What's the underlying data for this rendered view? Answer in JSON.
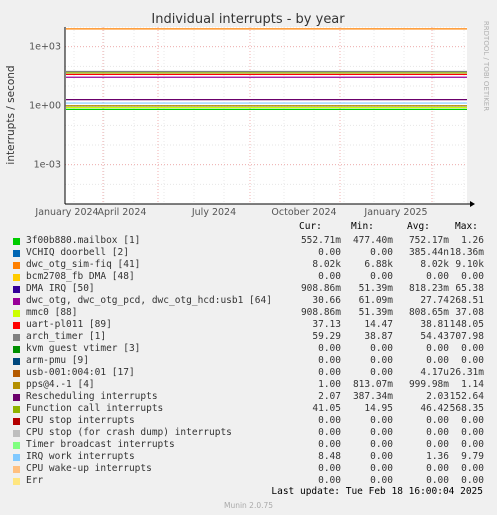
{
  "chart_data": {
    "type": "line",
    "title": "Individual interrupts - by year",
    "ylabel": "interrupts / second",
    "side_label": "RRDTOOL / TOBI OETIKER",
    "yscale": "log",
    "ylim": [
      1e-05,
      10000
    ],
    "y_ticks": [
      "1e+03",
      "1e+00",
      "1e-03"
    ],
    "x_ticks": [
      "January 2024",
      "April 2024",
      "July 2024",
      "October 2024",
      "January 2025"
    ],
    "grid": true,
    "series": [
      {
        "name": "3f00b880.mailbox [1]",
        "color": "#00CC00",
        "cur": "552.71m",
        "min": "477.40m",
        "avg": "752.17m",
        "max": "1.26",
        "level": 0.65
      },
      {
        "name": "VCHIQ doorbell [2]",
        "color": "#0066B3",
        "cur": "0.00",
        "min": "0.00",
        "avg": "385.44n",
        "max": "18.36m",
        "level": 1e-05
      },
      {
        "name": "dwc_otg_sim-fiq [41]",
        "color": "#FF8000",
        "cur": "8.02k",
        "min": "6.88k",
        "avg": "8.02k",
        "max": "9.10k",
        "level": 8020
      },
      {
        "name": "bcm2708_fb DMA [48]",
        "color": "#FFCC00",
        "cur": "0.00",
        "min": "0.00",
        "avg": "0.00",
        "max": "0.00",
        "level": 1e-05
      },
      {
        "name": "DMA IRQ [50]",
        "color": "#330099",
        "cur": "908.86m",
        "min": "51.39m",
        "avg": "818.23m",
        "max": "65.38",
        "level": 0.82
      },
      {
        "name": "dwc_otg, dwc_otg_pcd, dwc_otg_hcd:usb1 [64]",
        "color": "#990099",
        "cur": "30.66",
        "min": "61.09m",
        "avg": "27.74",
        "max": "268.51",
        "level": 27.74
      },
      {
        "name": "mmc0 [88]",
        "color": "#CCFF00",
        "cur": "908.86m",
        "min": "51.39m",
        "avg": "808.65m",
        "max": "37.08",
        "level": 0.81
      },
      {
        "name": "uart-pl011 [89]",
        "color": "#FF0000",
        "cur": "37.13",
        "min": "14.47",
        "avg": "38.81",
        "max": "148.05",
        "level": 38.81
      },
      {
        "name": "arch_timer [1]",
        "color": "#808080",
        "cur": "59.29",
        "min": "38.87",
        "avg": "54.43",
        "max": "707.98",
        "level": 54.43
      },
      {
        "name": "kvm guest vtimer [3]",
        "color": "#008F00",
        "cur": "0.00",
        "min": "0.00",
        "avg": "0.00",
        "max": "0.00",
        "level": 1e-05
      },
      {
        "name": "arm-pmu [9]",
        "color": "#00487D",
        "cur": "0.00",
        "min": "0.00",
        "avg": "0.00",
        "max": "0.00",
        "level": 1e-05
      },
      {
        "name": "usb-001:004:01 [17]",
        "color": "#B35A00",
        "cur": "0.00",
        "min": "0.00",
        "avg": "4.17u",
        "max": "26.31m",
        "level": 1e-05
      },
      {
        "name": "pps@4.-1 [4]",
        "color": "#B38F00",
        "cur": "1.00",
        "min": "813.07m",
        "avg": "999.98m",
        "max": "1.14",
        "level": 1.0
      },
      {
        "name": "Rescheduling interrupts",
        "color": "#6B006B",
        "cur": "2.07",
        "min": "387.34m",
        "avg": "2.03",
        "max": "152.64",
        "level": 2.03
      },
      {
        "name": "Function call interrupts",
        "color": "#8FB300",
        "cur": "41.05",
        "min": "14.95",
        "avg": "46.42",
        "max": "568.35",
        "level": 46.42
      },
      {
        "name": "CPU stop interrupts",
        "color": "#B30000",
        "cur": "0.00",
        "min": "0.00",
        "avg": "0.00",
        "max": "0.00",
        "level": 1e-05
      },
      {
        "name": "CPU stop (for crash dump) interrupts",
        "color": "#BEBEBE",
        "cur": "0.00",
        "min": "0.00",
        "avg": "0.00",
        "max": "0.00",
        "level": 1e-05
      },
      {
        "name": "Timer broadcast interrupts",
        "color": "#80FF80",
        "cur": "0.00",
        "min": "0.00",
        "avg": "0.00",
        "max": "0.00",
        "level": 1e-05
      },
      {
        "name": "IRQ work interrupts",
        "color": "#80C9FF",
        "cur": "8.48",
        "min": "0.00",
        "avg": "1.36",
        "max": "9.79",
        "level": 1.36
      },
      {
        "name": "CPU wake-up interrupts",
        "color": "#FFC080",
        "cur": "0.00",
        "min": "0.00",
        "avg": "0.00",
        "max": "0.00",
        "level": 1e-05
      },
      {
        "name": "Err",
        "color": "#FFE680",
        "cur": "0.00",
        "min": "0.00",
        "avg": "0.00",
        "max": "0.00",
        "level": 1e-05
      }
    ]
  },
  "legend_headers": {
    "cur": "Cur:",
    "min": "Min:",
    "avg": "Avg:",
    "max": "Max:"
  },
  "footer": {
    "last_update": "Last update: Tue Feb 18 16:00:04 2025",
    "munin": "Munin 2.0.75"
  }
}
